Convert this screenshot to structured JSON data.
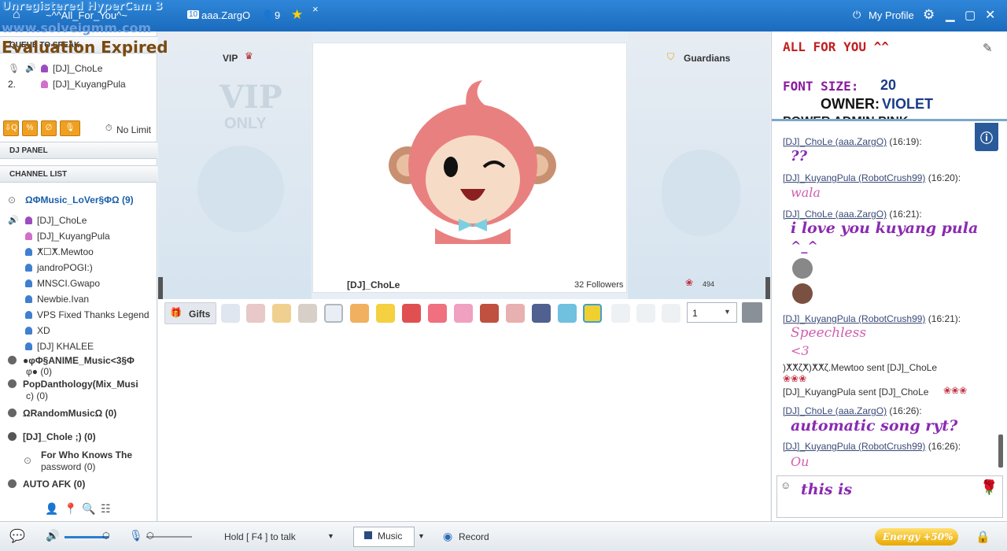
{
  "watermark": {
    "line1": "Unregistered HyperCam 3",
    "line2": "www.solveigmm.com",
    "line3": "Evaluation Expired"
  },
  "topbar": {
    "room_name": "~^^All_For_You^~",
    "user_label": "aaa.ZargO",
    "user_count": "9",
    "my_profile": "My Profile",
    "tab_close": "×"
  },
  "left": {
    "queue_title": "QUEUE TO SPEAK",
    "queue": [
      {
        "num": "1.",
        "name": "[DJ]_ChoLe"
      },
      {
        "num": "2.",
        "name": "[DJ]_KuyangPula"
      }
    ],
    "no_limit": "No Limit",
    "dj_panel": "DJ PANEL",
    "channel_list": "CHANNEL LIST",
    "current_channel": "ΩΦMusic_LoVer§ΦΩ (9)",
    "users": [
      "[DJ]_ChoLe",
      "[DJ]_KuyangPula",
      "ⵅ☐ⵅ.Mewtoo",
      "jandroPOGI:)",
      "MNSCI.Gwapo",
      "Newbie.Ivan",
      "VPS Fixed Thanks Legend",
      "XD",
      "[DJ] KHALEE"
    ],
    "channels": [
      {
        "l1": "●φΦ§ANIME_Music<3§Φ",
        "l2": "φ● (0)"
      },
      {
        "l1": "PopDanthology(Mix_Musi",
        "l2": "c) (0)"
      },
      {
        "l1": "ΩRandomMusicΩ (0)",
        "l2": ""
      },
      {
        "l1": "[DJ]_Chole ;) (0)",
        "l2": ""
      }
    ],
    "locked_channel": {
      "l1": "For Who Knows The",
      "l2": "password (0)"
    },
    "afk_channel": "AUTO AFK (0)"
  },
  "stage": {
    "vip": "VIP",
    "guardians": "Guardians",
    "vip_only_1": "VIP",
    "vip_only_2": "ONLY",
    "dj_name": "[DJ]_ChoLe",
    "followers": "32 Followers",
    "roses": "494"
  },
  "gifts": {
    "label": "Gifts",
    "qty": "1"
  },
  "right": {
    "room_info": {
      "l1": "ALL FOR YOU ^^",
      "l2_label": "FONT SIZE:",
      "l2_val": "20",
      "l3_label": "OWNER:",
      "l3_val": "VIOLET",
      "l4": "POWER ADMIN PINK"
    },
    "messages": [
      {
        "nick": "[DJ]_ChoLe (aaa.ZargO)",
        "time": "(16:19):",
        "text": "??"
      },
      {
        "nick": "[DJ]_KuyangPula (RobotCrush99)",
        "time": "(16:20):",
        "text": "wala"
      },
      {
        "nick": "[DJ]_ChoLe (aaa.ZargO)",
        "time": "(16:21):",
        "text": "i love you kuyang pula",
        "text2": "^_^"
      },
      {
        "nick": "[DJ]_KuyangPula (RobotCrush99)",
        "time": "(16:21):",
        "text": "Speechless",
        "text2": "<3"
      },
      {
        "sys": ")ⵅⵅζⵅ)ⵅⵅζ.Mewtoo sent [DJ]_ChoLe"
      },
      {
        "sys": "[DJ]_KuyangPula sent [DJ]_ChoLe"
      },
      {
        "nick": "[DJ]_ChoLe (aaa.ZargO)",
        "time": "(16:26):",
        "text": "automatic song ryt?"
      },
      {
        "nick": "[DJ]_KuyangPula (RobotCrush99)",
        "time": "(16:26):",
        "text": "Ou"
      }
    ],
    "input_value": "this is"
  },
  "bottom": {
    "hold": "Hold [ F4 ] to talk",
    "music": "Music",
    "record": "Record",
    "energy": "Energy +50%"
  },
  "colors": {
    "topbar": "#2378cc",
    "accent": "#f0a020",
    "chat_purple": "#8a2ab0",
    "chat_pink": "#d060b0"
  }
}
